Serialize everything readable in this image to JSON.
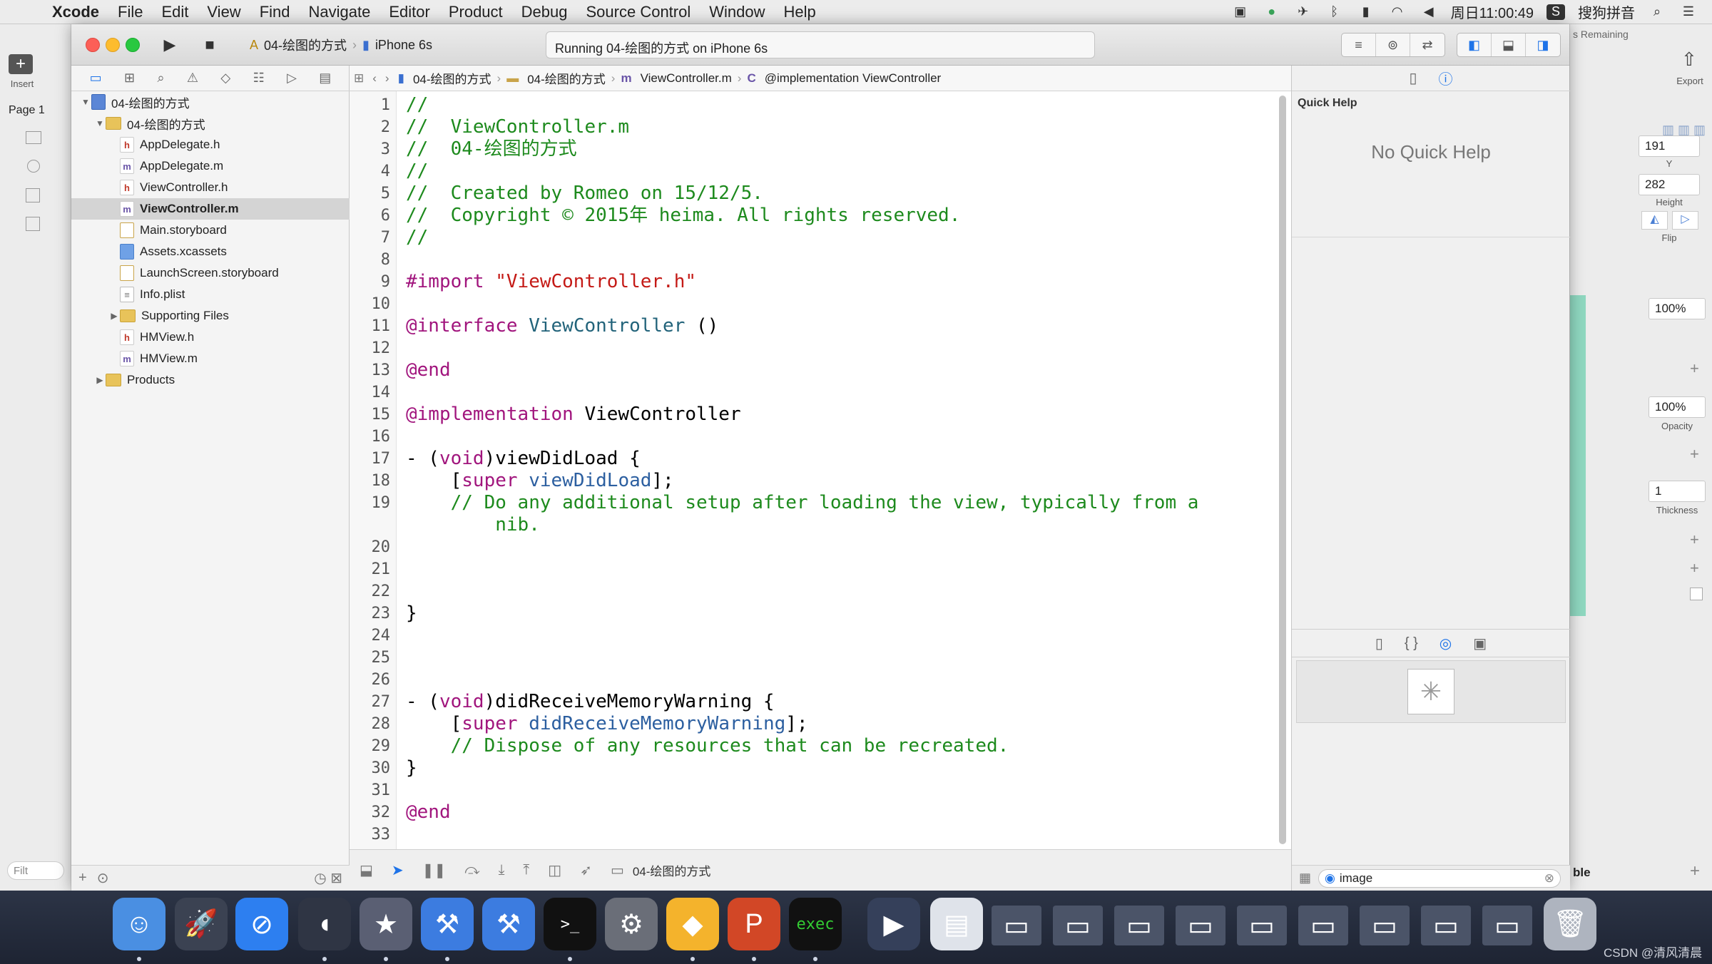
{
  "menubar": {
    "app": "Xcode",
    "items": [
      "File",
      "Edit",
      "View",
      "Find",
      "Navigate",
      "Editor",
      "Product",
      "Debug",
      "Source Control",
      "Window",
      "Help"
    ],
    "clock": "周日11:00:49",
    "input_method": "搜狗拼音"
  },
  "sketch": {
    "insert": "Insert",
    "page": "Page 1",
    "filter": "Filt",
    "export": "Export",
    "remaining": "s Remaining",
    "y_value": "191",
    "y_label": "Y",
    "height_value": "282",
    "height_label": "Height",
    "flip_label": "Flip",
    "percent1": "100%",
    "percent2": "100%",
    "opacity_label": "Opacity",
    "thickness_value": "1",
    "thickness_label": "Thickness",
    "partial_label": "ble"
  },
  "toolbar": {
    "scheme_project": "04-绘图的方式",
    "scheme_device": "iPhone 6s",
    "activity": "Running 04-绘图的方式 on iPhone 6s"
  },
  "navigator": {
    "rows": [
      {
        "label": "04-绘图的方式",
        "icon": "project-icon",
        "level": 0,
        "disclosure": "▼",
        "selected": false
      },
      {
        "label": "04-绘图的方式",
        "icon": "folder-icon",
        "level": 1,
        "disclosure": "▼",
        "selected": false
      },
      {
        "label": "AppDelegate.h",
        "icon": "h",
        "level": 2,
        "disclosure": "",
        "selected": false
      },
      {
        "label": "AppDelegate.m",
        "icon": "m",
        "level": 2,
        "disclosure": "",
        "selected": false
      },
      {
        "label": "ViewController.h",
        "icon": "h",
        "level": 2,
        "disclosure": "",
        "selected": false
      },
      {
        "label": "ViewController.m",
        "icon": "m",
        "level": 2,
        "disclosure": "",
        "selected": true
      },
      {
        "label": "Main.storyboard",
        "icon": "storyboard",
        "level": 2,
        "disclosure": "",
        "selected": false
      },
      {
        "label": "Assets.xcassets",
        "icon": "assets",
        "level": 2,
        "disclosure": "",
        "selected": false
      },
      {
        "label": "LaunchScreen.storyboard",
        "icon": "storyboard",
        "level": 2,
        "disclosure": "",
        "selected": false
      },
      {
        "label": "Info.plist",
        "icon": "plist",
        "level": 2,
        "disclosure": "",
        "selected": false
      },
      {
        "label": "Supporting Files",
        "icon": "folder-icon",
        "level": 2,
        "disclosure": "▶",
        "selected": false
      },
      {
        "label": "HMView.h",
        "icon": "h",
        "level": 2,
        "disclosure": "",
        "selected": false
      },
      {
        "label": "HMView.m",
        "icon": "m",
        "level": 2,
        "disclosure": "",
        "selected": false
      },
      {
        "label": "Products",
        "icon": "folder-icon",
        "level": 1,
        "disclosure": "▶",
        "selected": false
      }
    ]
  },
  "jumpbar": {
    "crumbs": [
      "04-绘图的方式",
      "04-绘图的方式",
      "ViewController.m",
      "@implementation ViewController"
    ]
  },
  "editor": {
    "lines": [
      {
        "n": "1",
        "html": "<span class=\"cm\">//</span>"
      },
      {
        "n": "2",
        "html": "<span class=\"cm\">//  ViewController.m</span>"
      },
      {
        "n": "3",
        "html": "<span class=\"cm\">//  04-绘图的方式</span>"
      },
      {
        "n": "4",
        "html": "<span class=\"cm\">//</span>"
      },
      {
        "n": "5",
        "html": "<span class=\"cm\">//  Created by Romeo on 15/12/5.</span>"
      },
      {
        "n": "6",
        "html": "<span class=\"cm\">//  Copyright © 2015年 heima. All rights reserved.</span>"
      },
      {
        "n": "7",
        "html": "<span class=\"cm\">//</span>"
      },
      {
        "n": "8",
        "html": ""
      },
      {
        "n": "9",
        "html": "<span class=\"kw\">#import</span> <span class=\"str\">\"ViewController.h\"</span>"
      },
      {
        "n": "10",
        "html": ""
      },
      {
        "n": "11",
        "html": "<span class=\"kw\">@interface</span> <span class=\"cls\">ViewController</span> ()"
      },
      {
        "n": "12",
        "html": ""
      },
      {
        "n": "13",
        "html": "<span class=\"kw\">@end</span>"
      },
      {
        "n": "14",
        "html": ""
      },
      {
        "n": "15",
        "html": "<span class=\"kw\">@implementation</span> ViewController"
      },
      {
        "n": "16",
        "html": ""
      },
      {
        "n": "17",
        "html": "- (<span class=\"kw\">void</span>)viewDidLoad {"
      },
      {
        "n": "18",
        "html": "    [<span class=\"kw\">super</span> <span class=\"mth\">viewDidLoad</span>];"
      },
      {
        "n": "19",
        "html": "    <span class=\"cm\">// Do any additional setup after loading the view, typically from a</span>"
      },
      {
        "n": "",
        "html": "        <span class=\"cm\">nib.</span>"
      },
      {
        "n": "20",
        "html": ""
      },
      {
        "n": "21",
        "html": ""
      },
      {
        "n": "22",
        "html": ""
      },
      {
        "n": "23",
        "html": "}"
      },
      {
        "n": "24",
        "html": ""
      },
      {
        "n": "25",
        "html": ""
      },
      {
        "n": "26",
        "html": ""
      },
      {
        "n": "27",
        "html": "- (<span class=\"kw\">void</span>)didReceiveMemoryWarning {"
      },
      {
        "n": "28",
        "html": "    [<span class=\"kw\">super</span> <span class=\"mth\">didReceiveMemoryWarning</span>];"
      },
      {
        "n": "29",
        "html": "    <span class=\"cm\">// Dispose of any resources that can be recreated.</span>"
      },
      {
        "n": "30",
        "html": "}"
      },
      {
        "n": "31",
        "html": ""
      },
      {
        "n": "32",
        "html": "<span class=\"kw\">@end</span>"
      },
      {
        "n": "33",
        "html": ""
      }
    ]
  },
  "debugbar": {
    "target": "04-绘图的方式"
  },
  "utilities": {
    "quick_help_title": "Quick Help",
    "no_quick_help": "No Quick Help",
    "filter_value": "image"
  },
  "dock": {
    "apps": [
      "finder-icon",
      "launchpad-icon",
      "safari-icon",
      "mouse-app-icon",
      "imovie-icon",
      "xcode-icon",
      "instruments-icon",
      "terminal-icon",
      "system-preferences-icon",
      "sketch-icon",
      "powerpoint-icon",
      "exec-console-icon",
      "quicktime-icon",
      "preview-icon",
      "window-thumb-icon",
      "window-thumb-icon",
      "window-thumb-icon",
      "window-thumb-icon",
      "window-thumb-icon",
      "window-thumb-icon",
      "window-thumb-icon",
      "window-thumb-icon",
      "window-thumb-icon",
      "trash-icon"
    ],
    "terminal_label": ">_",
    "exec_label": "exec"
  },
  "watermark": "CSDN @清风清晨",
  "colors": {
    "comment": "#1d8a1d",
    "keyword": "#a1157d",
    "string": "#c41a16",
    "class": "#22637a",
    "selection": "#bcd3f3",
    "navigator_selection": "#d4d4d4"
  }
}
